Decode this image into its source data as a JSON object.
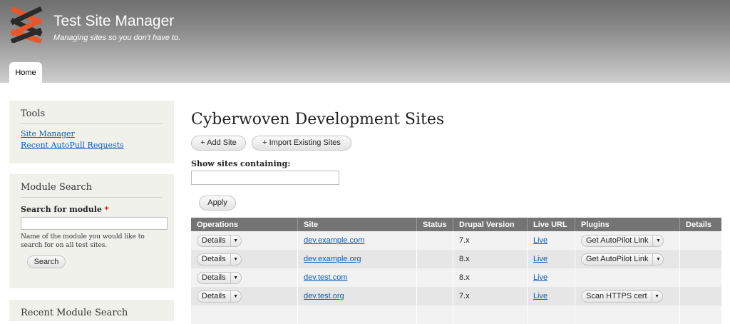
{
  "header": {
    "site_name": "Test Site Manager",
    "slogan": "Managing sites so you don't have to.",
    "tabs": [
      {
        "label": "Home"
      }
    ]
  },
  "sidebar": {
    "tools": {
      "title": "Tools",
      "links": [
        {
          "label": "Site Manager"
        },
        {
          "label": "Recent AutoPull Requests"
        }
      ]
    },
    "module_search": {
      "title": "Module Search",
      "field_label": "Search for module",
      "required_mark": "*",
      "value": "",
      "description": "Name of the module you would like to search for on all test sites.",
      "button": "Search"
    },
    "next_block_title": "Recent Module Search"
  },
  "main": {
    "title": "Cyberwoven Development Sites",
    "add_site_button": "+ Add Site",
    "import_button": "+ Import Existing Sites",
    "filter_label": "Show sites containing:",
    "filter_value": "",
    "apply_button": "Apply",
    "table": {
      "columns": [
        "Operations",
        "Site",
        "Status",
        "Drupal Version",
        "Live URL",
        "Plugins",
        "Details"
      ],
      "rows": [
        {
          "operation": "Details",
          "site": "dev.example.com",
          "status": "",
          "version": "7.x",
          "live": "Live",
          "plugin": "Get AutoPilot Link",
          "details": ""
        },
        {
          "operation": "Details",
          "site": "dev.example.org",
          "status": "",
          "version": "8.x",
          "live": "Live",
          "plugin": "Get AutoPilot Link",
          "details": ""
        },
        {
          "operation": "Details",
          "site": "dev.test.com",
          "status": "",
          "version": "8.x",
          "live": "Live",
          "plugin": "",
          "details": ""
        },
        {
          "operation": "Details",
          "site": "dev.test.org",
          "status": "",
          "version": "7.x",
          "live": "Live",
          "plugin": "Scan HTTPS cert",
          "details": ""
        }
      ]
    }
  },
  "colors": {
    "link": "#0b5db3",
    "table_header": "#747474",
    "sidebar_bg": "#f1f1ec",
    "logo_orange": "#e8562a",
    "logo_dark": "#2b2b2b",
    "required": "#dd0000"
  }
}
